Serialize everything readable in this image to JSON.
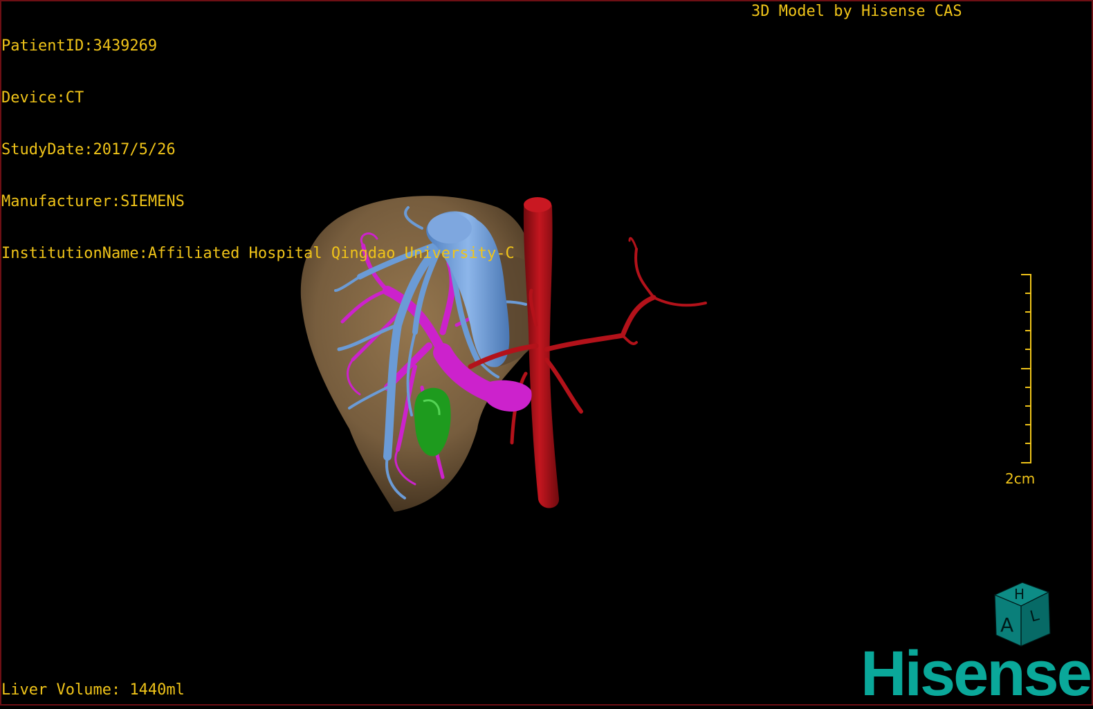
{
  "overlay": {
    "patient_id": "PatientID:3439269",
    "device": "Device:CT",
    "study_date": "StudyDate:2017/5/26",
    "manufacturer": "Manufacturer:SIEMENS",
    "institution": "InstitutionName:Affiliated Hospital Qingdao University-C",
    "credit": "3D Model by Hisense CAS",
    "liver_volume": "Liver Volume: 1440ml"
  },
  "scale_bar": {
    "label": "2cm"
  },
  "orientation_cube": {
    "top_face": "H",
    "front_face": "A",
    "side_face": "L",
    "color": "#0a7f7a"
  },
  "brand": {
    "name": "Hisense",
    "color": "#0aa89a"
  },
  "colors": {
    "text": "#f0c419",
    "liver": "#8a6d48",
    "hepatic_vein": "#6b9bd6",
    "portal_vein": "#cc22cc",
    "artery": "#b3121a",
    "gallbladder": "#1e9b1e"
  }
}
